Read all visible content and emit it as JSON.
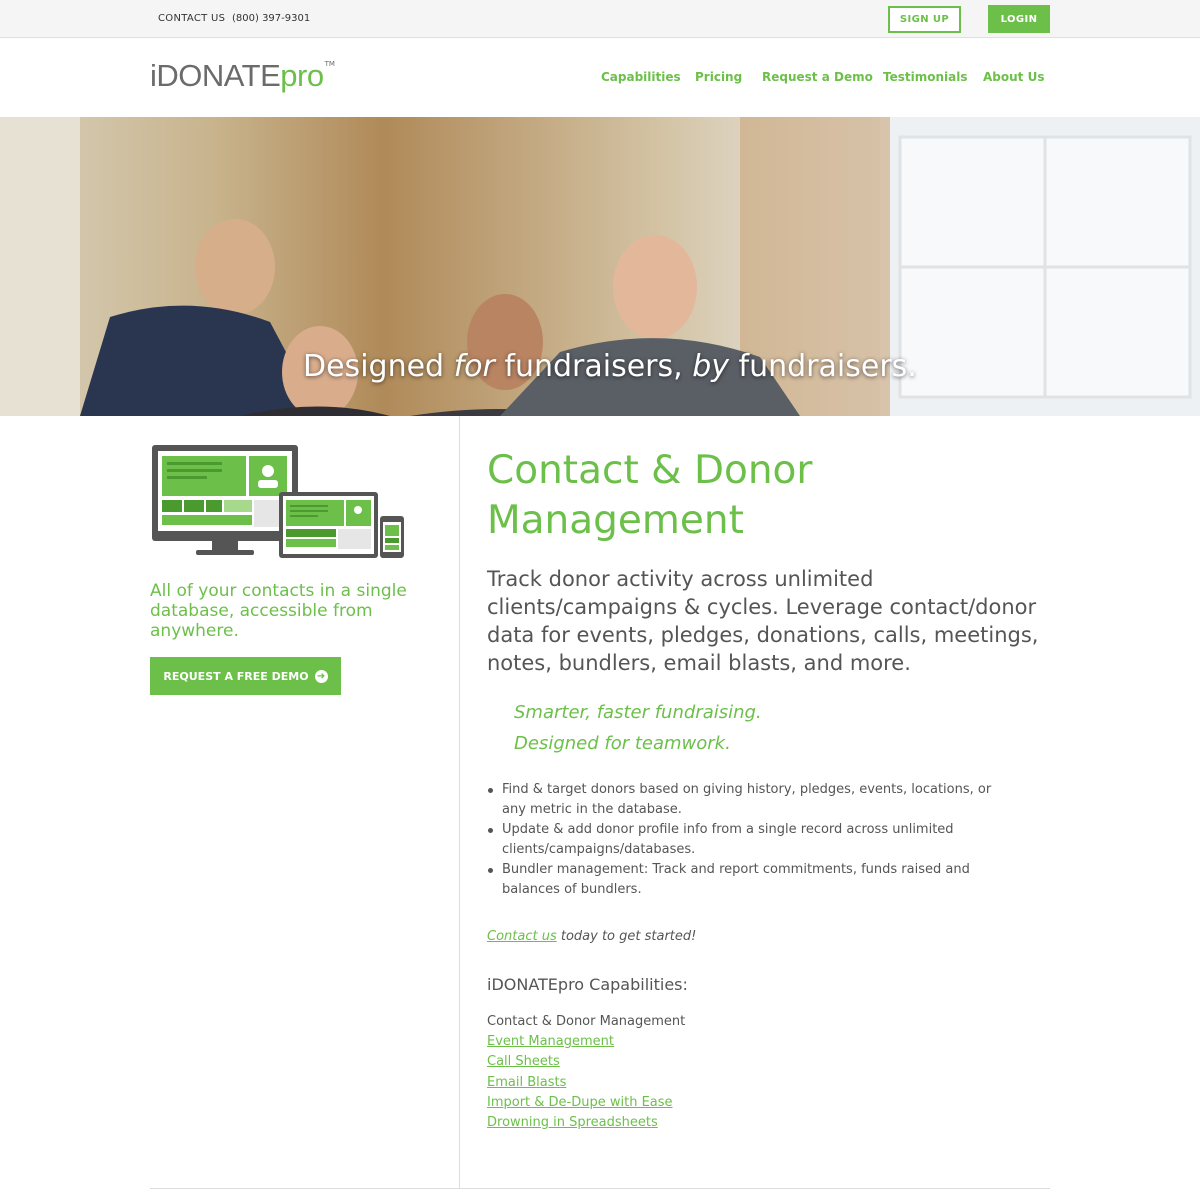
{
  "topbar": {
    "contact_label": "CONTACT US",
    "phone": "(800) 397-9301",
    "signup_label": "SIGN UP",
    "login_label": "LOGIN"
  },
  "header": {
    "logo_prefix": "iDONATE",
    "logo_suffix": "pro",
    "logo_tm": "TM",
    "nav": [
      "Capabilities",
      "Pricing",
      "Request a Demo",
      "Testimonials",
      "About Us"
    ]
  },
  "hero": {
    "part1": "Designed ",
    "part2_italic": "for",
    "part3": " fundraisers, ",
    "part4_italic": "by",
    "part5": " fundraisers."
  },
  "sidebar": {
    "tagline": "All of your contacts in a single database, accessible from anywhere.",
    "demo_button": "REQUEST A FREE DEMO"
  },
  "main": {
    "title": "Contact & Donor Management",
    "lead": "Track donor activity across unlimited clients/campaigns & cycles. Leverage contact/donor data for events, pledges, donations, calls, meetings, notes, bundlers, email blasts, and more.",
    "tagline1": "Smarter, faster fundraising.",
    "tagline2": "Designed for teamwork.",
    "features": [
      "Find & target donors based on giving history, pledges, events, locations, or any metric in the database.",
      "Update & add donor profile info from a single record across unlimited clients/campaigns/databases.",
      "Bundler management: Track and report commitments, funds raised and balances of bundlers."
    ],
    "cta_link": "Contact us",
    "cta_rest": " today to get started!",
    "capabilities_heading": "iDONATEpro Capabilities:",
    "capabilities_current": "Contact & Donor Management",
    "capabilities_links": [
      "Event Management",
      "Call Sheets",
      "Email Blasts",
      "Import & De-Dupe with Ease",
      "Drowning in Spreadsheets"
    ]
  },
  "colors": {
    "accent": "#6cc04a",
    "text": "#555555"
  }
}
